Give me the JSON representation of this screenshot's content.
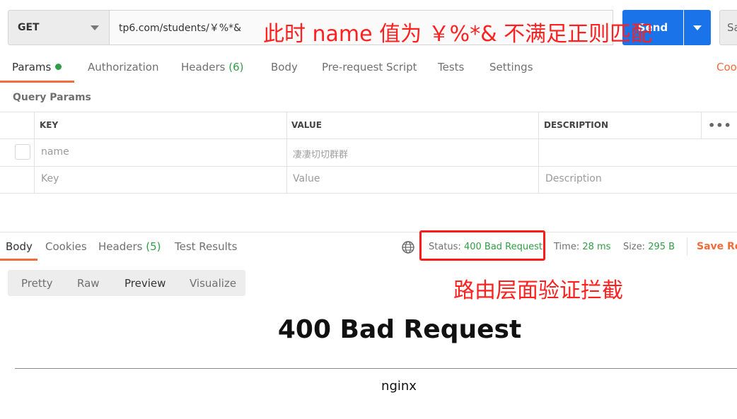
{
  "request": {
    "method": "GET",
    "url": "tp6.com/students/￥%*&",
    "send_label": "Send",
    "save_label": "Sa"
  },
  "annotations": {
    "top": "此时 name 值为 ￥%*& 不满足正则匹配",
    "middle": "路由层面验证拦截"
  },
  "request_tabs": {
    "params": "Params",
    "authorization": "Authorization",
    "headers": "Headers",
    "headers_count": "(6)",
    "body": "Body",
    "prerequest": "Pre-request Script",
    "tests": "Tests",
    "settings": "Settings",
    "cookies": "Coo"
  },
  "query_params": {
    "title": "Query Params",
    "columns": [
      "KEY",
      "VALUE",
      "DESCRIPTION"
    ],
    "rows": [
      {
        "key": "name",
        "value": "凄凄切切群群",
        "description": ""
      }
    ],
    "placeholders": {
      "key": "Key",
      "value": "Value",
      "description": "Description"
    }
  },
  "response_tabs": {
    "body": "Body",
    "cookies": "Cookies",
    "headers": "Headers",
    "headers_count": "(5)",
    "test_results": "Test Results"
  },
  "response_meta": {
    "status_label": "Status:",
    "status_value": "400 Bad Request",
    "time_label": "Time:",
    "time_value": "28 ms",
    "size_label": "Size:",
    "size_value": "295 B",
    "save_response": "Save Res"
  },
  "view_modes": [
    "Pretty",
    "Raw",
    "Preview",
    "Visualize"
  ],
  "selected_view": "Preview",
  "response_body": {
    "title": "400 Bad Request",
    "footer": "nginx"
  },
  "colors": {
    "accent": "#f26b3a",
    "send": "#1a73e8",
    "success": "#2f9e44",
    "annotation": "#ff2020"
  }
}
